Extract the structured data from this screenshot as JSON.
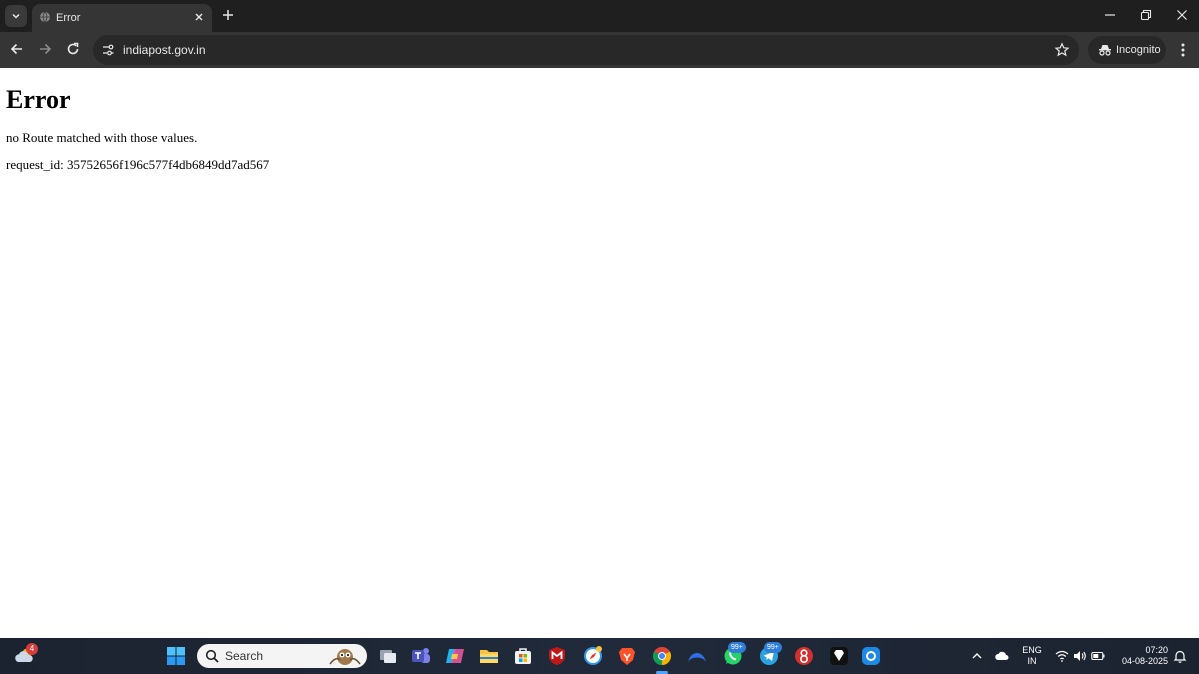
{
  "browser": {
    "tab": {
      "title": "Error"
    },
    "address_bar": {
      "url": "indiapost.gov.in"
    },
    "incognito_label": "Incognito"
  },
  "page": {
    "heading": "Error",
    "message": "no Route matched with those values.",
    "request_id": "request_id: 35752656f196c577f4db6849dd7ad567"
  },
  "taskbar": {
    "weather_badge": "4",
    "search_placeholder": "Search",
    "badges": {
      "whatsapp": "99+",
      "telegram": "99+"
    },
    "language": {
      "line1": "ENG",
      "line2": "IN"
    },
    "clock": {
      "time": "07:20",
      "date": "04-08-2025"
    }
  },
  "colors": {
    "tab_strip": "#1f1f1f",
    "toolbar": "#353535",
    "omnibox": "#282828",
    "taskbar": "#1c2330",
    "accent": "#4da3ff"
  }
}
